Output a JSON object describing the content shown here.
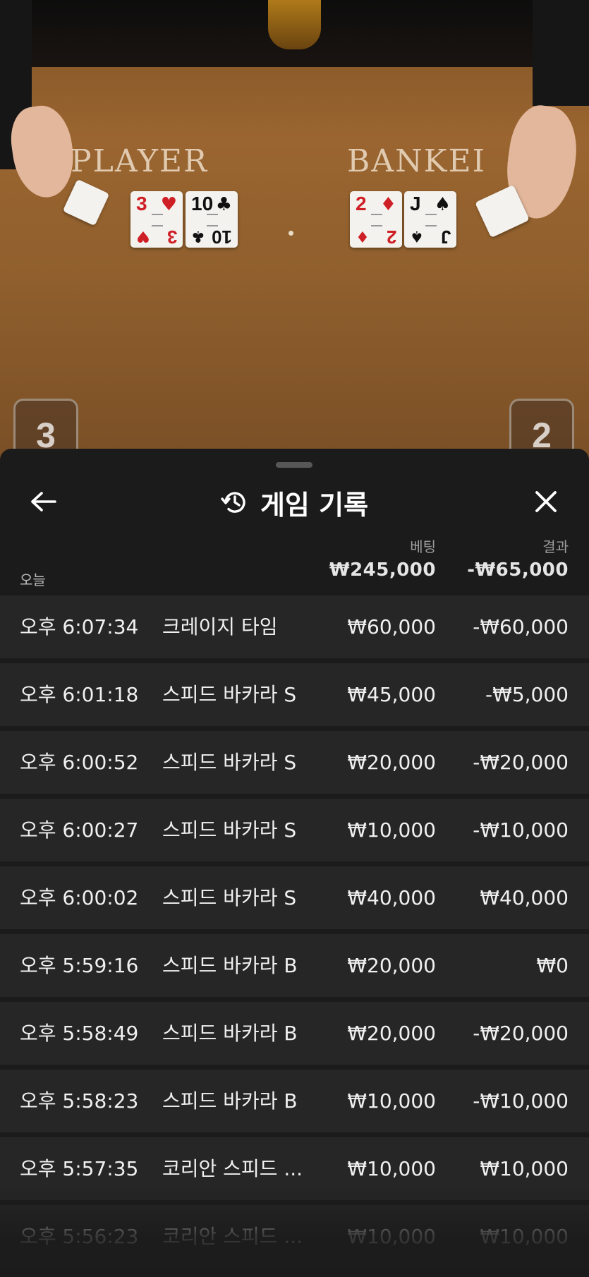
{
  "video": {
    "zone_player": "PLAYER",
    "zone_banker": "BANKEI",
    "player_score": "3",
    "banker_score": "2",
    "player_cards": [
      {
        "rank": "3",
        "suit": "♥",
        "color": "red"
      },
      {
        "rank": "10",
        "suit": "♣",
        "color": "black"
      }
    ],
    "banker_cards": [
      {
        "rank": "2",
        "suit": "♦",
        "color": "red"
      },
      {
        "rank": "J",
        "suit": "♠",
        "color": "black"
      }
    ]
  },
  "sheet": {
    "title": "게임 기록",
    "title_icon": "history-icon",
    "back_icon": "arrow-left-icon",
    "close_icon": "close-icon",
    "header": {
      "today": "오늘",
      "bet_label": "베팅",
      "result_label": "결과",
      "bet_total": "₩245,000",
      "result_total": "-₩65,000"
    },
    "rows": [
      {
        "time": "오후 6:07:34",
        "game": "크레이지 타임",
        "bet": "₩60,000",
        "result": "-₩60,000"
      },
      {
        "time": "오후 6:01:18",
        "game": "스피드 바카라 S",
        "bet": "₩45,000",
        "result": "-₩5,000"
      },
      {
        "time": "오후 6:00:52",
        "game": "스피드 바카라 S",
        "bet": "₩20,000",
        "result": "-₩20,000"
      },
      {
        "time": "오후 6:00:27",
        "game": "스피드 바카라 S",
        "bet": "₩10,000",
        "result": "-₩10,000"
      },
      {
        "time": "오후 6:00:02",
        "game": "스피드 바카라 S",
        "bet": "₩40,000",
        "result": "₩40,000"
      },
      {
        "time": "오후 5:59:16",
        "game": "스피드 바카라 B",
        "bet": "₩20,000",
        "result": "₩0"
      },
      {
        "time": "오후 5:58:49",
        "game": "스피드 바카라 B",
        "bet": "₩20,000",
        "result": "-₩20,000"
      },
      {
        "time": "오후 5:58:23",
        "game": "스피드 바카라 B",
        "bet": "₩10,000",
        "result": "-₩10,000"
      },
      {
        "time": "오후 5:57:35",
        "game": "코리안 스피드 ...",
        "bet": "₩10,000",
        "result": "₩10,000"
      },
      {
        "time": "오후 5:56:23",
        "game": "코리안 스피드 ...",
        "bet": "₩10,000",
        "result": "₩10,000"
      }
    ]
  }
}
